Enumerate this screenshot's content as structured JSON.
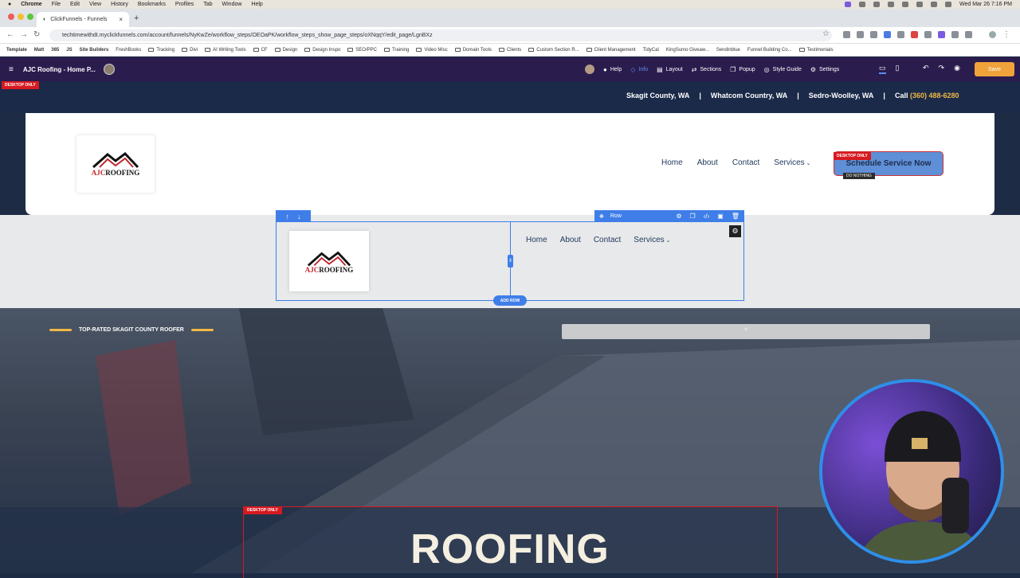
{
  "menubar": {
    "app": "Chrome",
    "items": [
      "File",
      "Edit",
      "View",
      "History",
      "Bookmarks",
      "Profiles",
      "Tab",
      "Window",
      "Help"
    ],
    "clock": "Wed Mar 26  7:16 PM"
  },
  "browser": {
    "tab_title": "ClickFunnels - Funnels",
    "url": "techtimewithdt.myclickfunnels.com/account/funnels/NyKwZe/workflow_steps/OEOaPK/workflow_steps_show_page_steps/oXNqqY/edit_page/LgnBXz"
  },
  "bookmarks": [
    {
      "label": "Template",
      "kind": "tag"
    },
    {
      "label": "Matt",
      "kind": "tag"
    },
    {
      "label": "365",
      "kind": "tag"
    },
    {
      "label": "JS",
      "kind": "tag"
    },
    {
      "label": "Site Builders",
      "kind": "tag"
    },
    {
      "label": "FreshBooks",
      "kind": "link"
    },
    {
      "label": "Tracking",
      "kind": "folder"
    },
    {
      "label": "Divi",
      "kind": "folder"
    },
    {
      "label": "AI Writing Tools",
      "kind": "folder"
    },
    {
      "label": "CF",
      "kind": "folder"
    },
    {
      "label": "Design",
      "kind": "folder"
    },
    {
      "label": "Design Inspo",
      "kind": "folder"
    },
    {
      "label": "SEO/PPC",
      "kind": "folder"
    },
    {
      "label": "Training",
      "kind": "folder"
    },
    {
      "label": "Video Misc",
      "kind": "folder"
    },
    {
      "label": "Domain Tools",
      "kind": "folder"
    },
    {
      "label": "Clients",
      "kind": "folder"
    },
    {
      "label": "Custom Section R...",
      "kind": "folder"
    },
    {
      "label": "Client Management",
      "kind": "folder"
    },
    {
      "label": "TidyCal",
      "kind": "link"
    },
    {
      "label": "KingSumo Giveaw...",
      "kind": "link"
    },
    {
      "label": "Sendinblue",
      "kind": "link"
    },
    {
      "label": "Funnel Building Co...",
      "kind": "link"
    },
    {
      "label": "Testimonials",
      "kind": "folder"
    }
  ],
  "editor": {
    "page_title": "AJC Roofing - Home P...",
    "nav": [
      "Help",
      "Info",
      "Layout",
      "Sections",
      "Popup",
      "Style Guide",
      "Settings"
    ],
    "save": "Save"
  },
  "site": {
    "desktop_only": "DESKTOP ONLY",
    "locations": [
      "Skagit County, WA",
      "|",
      "Whatcom Country, WA",
      "|",
      "Sedro-Woolley,  WA",
      "|"
    ],
    "call_label": "Call",
    "phone": "(360) 488-6280",
    "logo_aj": "AJC",
    "logo_rest": "ROOFING",
    "nav": [
      "Home",
      "About",
      "Contact",
      "Services"
    ],
    "cta": "Schedule Service Now",
    "do_nothing": "DO NOTHING",
    "row_label": "Row",
    "add_row": "ADD ROW",
    "tagline": "TOP-RATED SKAGIT COUNTY ROOFER",
    "big_word": "ROOFING"
  },
  "colors": {
    "accent": "#3f7ee8",
    "brand_gold": "#f0b847",
    "toolbar": "#2b1c4e",
    "navy": "#1b2a48",
    "save": "#f0a33a",
    "warning": "#d71920"
  }
}
